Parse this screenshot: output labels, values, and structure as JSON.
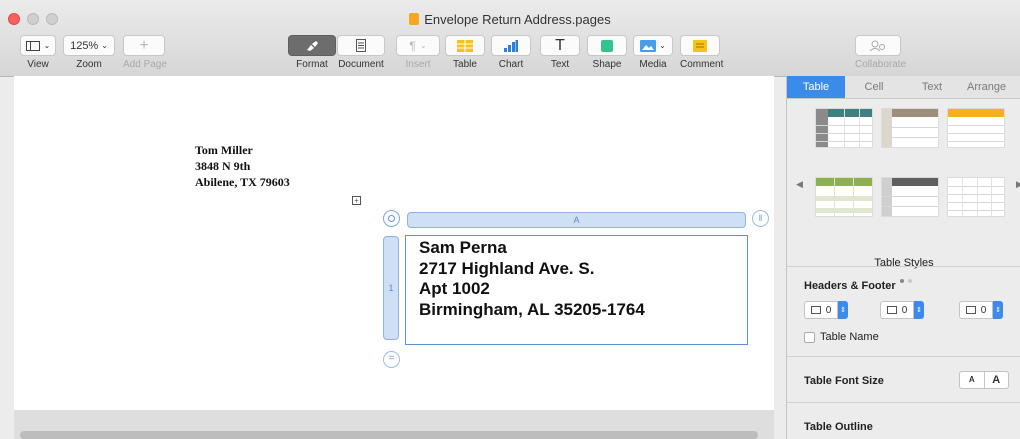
{
  "window": {
    "title": "Envelope Return Address.pages"
  },
  "toolbar": {
    "view": {
      "label": "View",
      "icon": "sidebar-icon"
    },
    "zoom": {
      "label": "Zoom",
      "value": "125%"
    },
    "add_page": {
      "label": "Add Page",
      "icon": "plus-icon"
    },
    "format": {
      "label": "Format",
      "icon": "paintbrush-icon"
    },
    "document": {
      "label": "Document",
      "icon": "document-icon"
    },
    "insert": {
      "label": "Insert",
      "icon": "pilcrow-icon"
    },
    "table": {
      "label": "Table",
      "icon": "table-icon"
    },
    "chart": {
      "label": "Chart",
      "icon": "chart-icon"
    },
    "text": {
      "label": "Text",
      "icon": "text-box-icon",
      "glyph": "T"
    },
    "shape": {
      "label": "Shape",
      "icon": "shape-icon"
    },
    "media": {
      "label": "Media",
      "icon": "media-icon"
    },
    "comment": {
      "label": "Comment",
      "icon": "comment-icon"
    },
    "collaborate": {
      "label": "Collaborate",
      "icon": "collaborate-icon"
    }
  },
  "document": {
    "return_address": {
      "line1": "Tom Miller",
      "line2": "3848 N 9th",
      "line3": "Abilene, TX 79603"
    },
    "table": {
      "column_label": "A",
      "row_label": "1",
      "recipient": {
        "line1": "Sam Perna",
        "line2": "2717 Highland Ave. S.",
        "line3": "Apt 1002",
        "line4": "Birmingham, AL 35205-1764"
      }
    }
  },
  "inspector": {
    "tabs": [
      "Table",
      "Cell",
      "Text",
      "Arrange"
    ],
    "active_tab": "Table",
    "table_styles_label": "Table Styles",
    "style_colors": [
      "#3f7f80",
      "#9e8f7d",
      "#f3b11c",
      "#8db14c",
      "#5f5f5f",
      "#dcdcdc"
    ],
    "headers_footer": {
      "title": "Headers & Footer",
      "header_rows": "0",
      "header_columns": "0",
      "footer_rows": "0"
    },
    "table_name_label": "Table Name",
    "table_name_checked": false,
    "font_size": {
      "title": "Table Font Size",
      "smaller": "A",
      "larger": "A"
    },
    "outline_title": "Table Outline"
  }
}
